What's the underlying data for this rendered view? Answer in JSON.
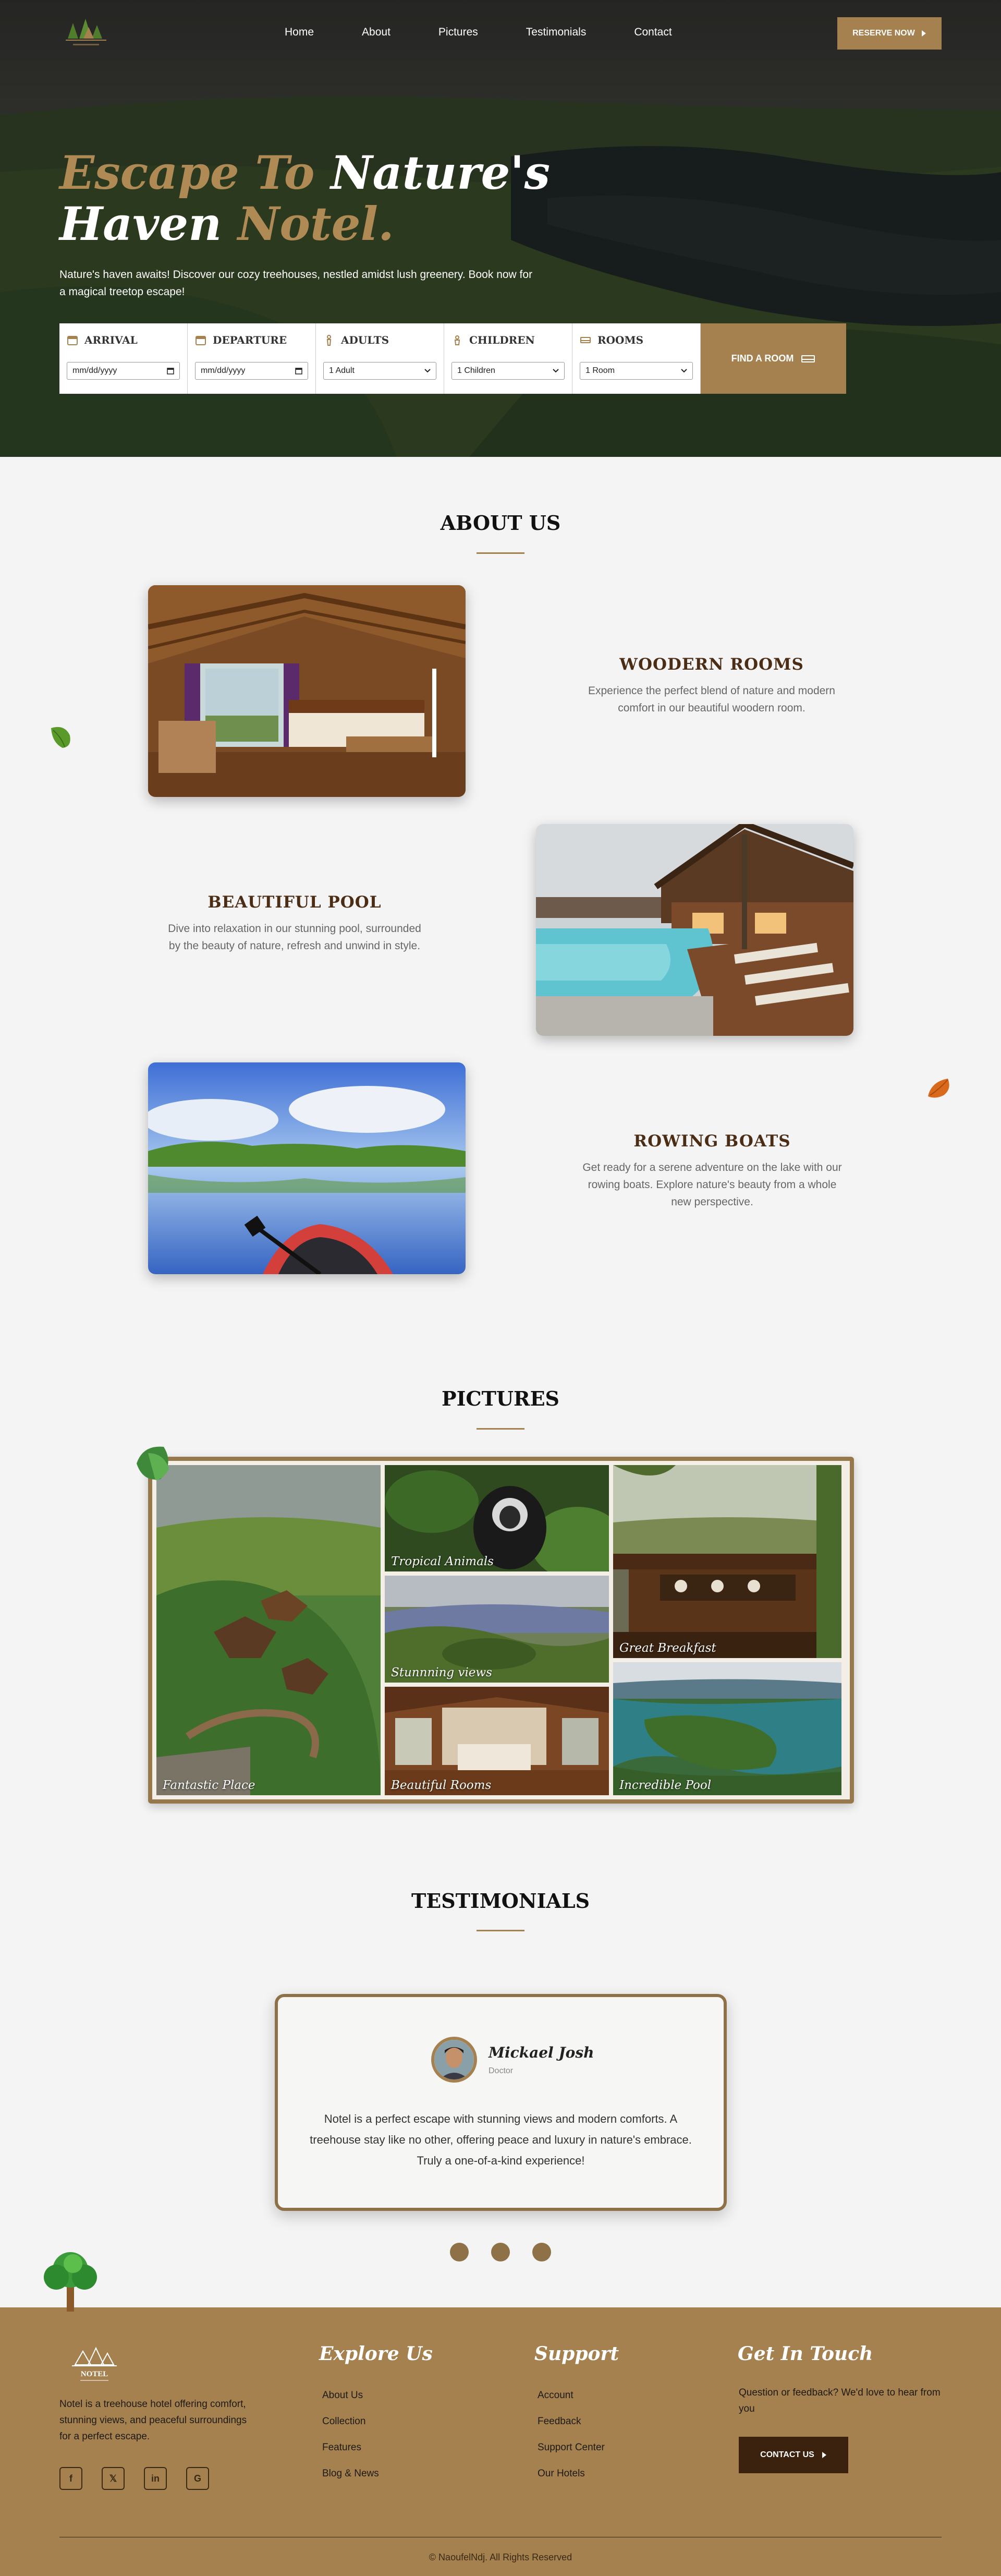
{
  "nav": {
    "items": [
      "Home",
      "About",
      "Pictures",
      "Testimonials",
      "Contact"
    ],
    "reserve_label": "RESERVE NOW"
  },
  "hero": {
    "title_part1": "Escape To",
    "title_part2": " Nature's",
    "title_part3": "Haven",
    "title_part4": " Notel.",
    "subtitle": "Nature's haven awaits! Discover our cozy treehouses, nestled amidst lush greenery. Book now for a magical treetop escape!"
  },
  "booking": {
    "arrival_label": "ARRIVAL",
    "arrival_value": "mm/dd/yyyy",
    "departure_label": "DEPARTURE",
    "departure_value": "mm/dd/yyyy",
    "adults_label": "ADULTS",
    "adults_value": "1 Adult",
    "children_label": "CHILDREN",
    "children_value": "1 Children",
    "rooms_label": "ROOMS",
    "rooms_value": "1 Room",
    "find_label": "FIND A ROOM"
  },
  "about": {
    "title": "ABOUT US",
    "features": [
      {
        "title": "WOODERN ROOMS",
        "text": "Experience the perfect blend of nature and modern comfort in our beautiful woodern room."
      },
      {
        "title": "BEAUTIFUL POOL",
        "text": "Dive into relaxation in our stunning pool, surrounded by the beauty of nature, refresh and unwind in style."
      },
      {
        "title": "ROWING BOATS",
        "text": "Get ready for a serene adventure on the lake with our rowing boats. Explore nature's beauty from a whole new perspective."
      }
    ]
  },
  "pictures": {
    "title": "PICTURES",
    "captions": [
      "Fantastic Place",
      "Tropical Animals",
      "Stunnning views",
      "Beautiful Rooms",
      "Great Breakfast",
      "Incredible Pool"
    ]
  },
  "testimonials": {
    "title": "TESTIMONIALS",
    "name": "Mickael Josh",
    "role": "Doctor",
    "quote": "Notel is a perfect escape with stunning views and modern comforts. A treehouse stay like no other, offering peace and luxury in nature's embrace. Truly a one-of-a-kind experience!"
  },
  "footer": {
    "logo_text": "NOTEL",
    "description": "Notel is a treehouse hotel offering comfort, stunning views, and peaceful surroundings for a perfect escape.",
    "explore_title": "Explore Us",
    "explore_links": [
      "About Us",
      "Collection",
      "Features",
      "Blog & News"
    ],
    "support_title": "Support",
    "support_links": [
      "Account",
      "Feedback",
      "Support Center",
      "Our Hotels"
    ],
    "contact_title": "Get In Touch",
    "contact_text": "Question or feedback? We'd love to hear from you",
    "contact_label": "CONTACT US",
    "copyright": "© NaoufelNdj. All Rights Reserved"
  },
  "colors": {
    "accent": "#a5814f",
    "dark_brown": "#3a220e",
    "heading_brown": "#4b2c15"
  }
}
